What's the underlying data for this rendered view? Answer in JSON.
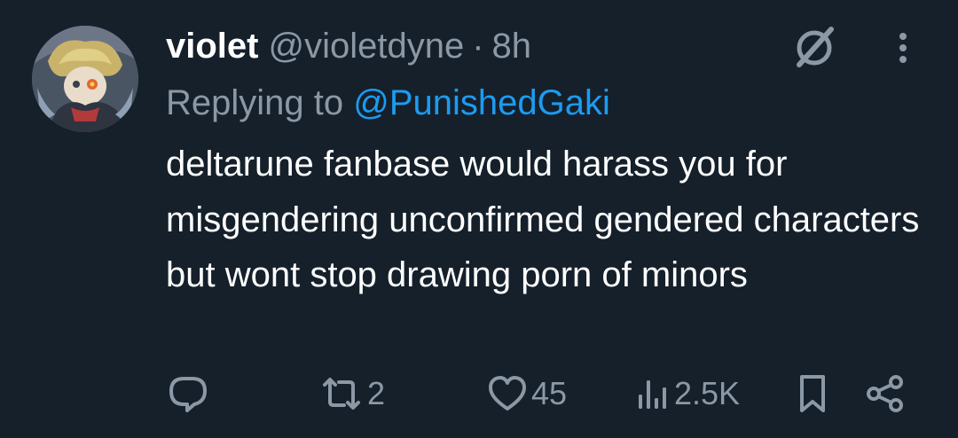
{
  "tweet": {
    "display_name": "violet",
    "handle": "@violetdyne",
    "separator": "·",
    "time": "8h",
    "replying_prefix": "Replying to",
    "replying_to": "@PunishedGaki",
    "text": "deltarune fanbase would harass you for misgendering unconfirmed gendered characters but wont stop drawing porn of minors"
  },
  "actions": {
    "reposts": "2",
    "likes": "45",
    "views": "2.5K"
  },
  "icons": {
    "reply": "reply-icon",
    "repost": "repost-icon",
    "like": "heart-icon",
    "views": "views-icon",
    "bookmark": "bookmark-icon",
    "share": "share-icon",
    "grok": "grok-icon",
    "more": "more-icon"
  },
  "colors": {
    "background": "#15202b",
    "text_primary": "#ffffff",
    "text_secondary": "#8b98a5",
    "link": "#1d9bf0"
  }
}
